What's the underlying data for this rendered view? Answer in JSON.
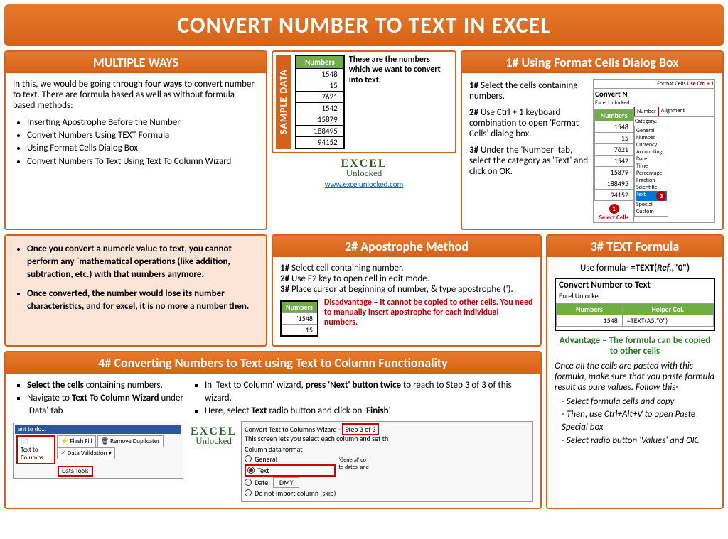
{
  "title": "CONVERT NUMBER TO TEXT IN EXCEL",
  "multipleWays": {
    "header": "MULTIPLE WAYS",
    "intro1": "In this, we would be going through ",
    "introBold": "four ways",
    "intro2": " to convert number to text. There are formula based as well as without formula based methods:",
    "items": [
      "Inserting Apostrophe Before the Number",
      "Convert Numbers Using TEXT Formula",
      "Using Format Cells Dialog Box",
      "Convert Numbers To Text Using Text To Column Wizard"
    ]
  },
  "sample": {
    "label": "SAMPLE DATA",
    "header": "Numbers",
    "values": [
      "1548",
      "15",
      "7621",
      "1542",
      "15879",
      "188495",
      "94152"
    ],
    "sideText": "These are the numbers which we want to convert into text.",
    "logoLine1": "EXCEL",
    "logoLine2": "Unlocked",
    "link": "www.excelunlocked.com"
  },
  "formatCells": {
    "header": "1# Using Format Cells Dialog Box",
    "s1a": "1#",
    "s1b": " Select the cells containing numbers.",
    "s2a": "2#",
    "s2b": " Use Ctrl + 1 keyboard combination to open 'Format Cells' dialog box.",
    "s3a": "3#",
    "s3b": " Under the 'Number' tab, select the category as 'Text' and click on OK.",
    "imgTitle": "Convert N",
    "imgSub": "Excel Unlocked",
    "tabLabel": "Format Cells",
    "tabHint": "Use Ctrl + 1",
    "tabNumber": "Number",
    "tabAlign": "Alignment",
    "catLabel": "Category:",
    "cats": [
      "General",
      "Number",
      "Currency",
      "Accounting",
      "Date",
      "Time",
      "Percentage",
      "Fraction",
      "Scientific",
      "Text",
      "Special",
      "Custom"
    ],
    "selectCells": "Select Cells"
  },
  "notes": {
    "n1a": "Once you convert a numeric value to text, you cannot perform any `mathematical operations (like addition, subtraction, etc.) with that numbers anymore.",
    "n2a": "Once converted, the number would lose its number characteristics, and for excel, it is no more a number then."
  },
  "apostrophe": {
    "header": "2# Apostrophe Method",
    "s1": "1# Select cell containing number.",
    "s2": "2# Use F2 key to open cell in edit mode.",
    "s3": "3# Place cursor at beginning of number, & type apostrophe (').",
    "tblHead": "Numbers",
    "tblVal1": "'1548",
    "tblVal2": "15",
    "disadv": "Disadvantage – It cannot be copied to other cells. You need to manually insert apostrophe for each individual numbers."
  },
  "textFormula": {
    "header": "3# TEXT Formula",
    "usePrefix": "Use formula-  ",
    "useFormula": "=TEXT(Ref.,\"0\")",
    "imgTitle": "Convert Number to Text",
    "imgSub": "Excel Unlocked",
    "col1": "Numbers",
    "col2": "Helper Col.",
    "val1": "1548",
    "val2": "=TEXT(A5,\"0\")",
    "adv": "Advantage – The formula can be copied to other cells",
    "followIntro": "Once all the cells are pasted with this formula, make sure that you paste formula result as pure values. Follow this-",
    "steps": [
      "Select formula cells and copy",
      "Then, use Ctrl+Alt+V to open Paste Special box",
      "Select radio button 'Values' and OK."
    ]
  },
  "textToColumn": {
    "header": "4# Converting Numbers to Text using Text to Column Functionality",
    "left1a": "Select the cells",
    "left1b": " containing numbers.",
    "left2a": "Navigate to ",
    "left2b": "Text To Column Wizard",
    "left2c": " under 'Data' tab",
    "right1a": "In 'Text to Column' wizard, ",
    "right1b": "press 'Next' button twice",
    "right1c": " to reach to Step 3 of 3 of this wizard.",
    "right2a": "Here, select ",
    "right2b": "Text",
    "right2c": " radio button and click on '",
    "right2d": "Finish",
    "right2e": "'",
    "wizardTitle": "Convert Text to Columns Wizard - ",
    "wizardStep": "Step 3 of 3",
    "wizardDesc": "This screen lets you select each column and set th",
    "colFormat": "Column data format",
    "optGeneral": "General",
    "optText": "Text",
    "optDate": "Date:",
    "optDateVal": "DMY",
    "optSkip": "Do not import column (skip)",
    "hint": "'General' co\nto dates, and",
    "ribbon": {
      "want": "ant to do...",
      "flashFill": "Flash Fill",
      "removeDup": "Remove Duplicates",
      "dataVal": "Data Validation",
      "textToCol": "Text to Columns",
      "dataTools": "Data Tools"
    }
  }
}
